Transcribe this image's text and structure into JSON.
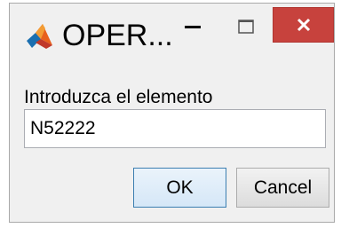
{
  "window": {
    "title": "OPER...",
    "app_icon": "matlab-icon",
    "controls": {
      "minimize_icon": "minimize-icon",
      "maximize_icon": "maximize-icon",
      "close_icon": "close-icon",
      "close_color": "#c7423d"
    }
  },
  "dialog": {
    "prompt": "Introduzca el elemento",
    "input_value": "N52222",
    "ok_label": "OK",
    "cancel_label": "Cancel"
  }
}
